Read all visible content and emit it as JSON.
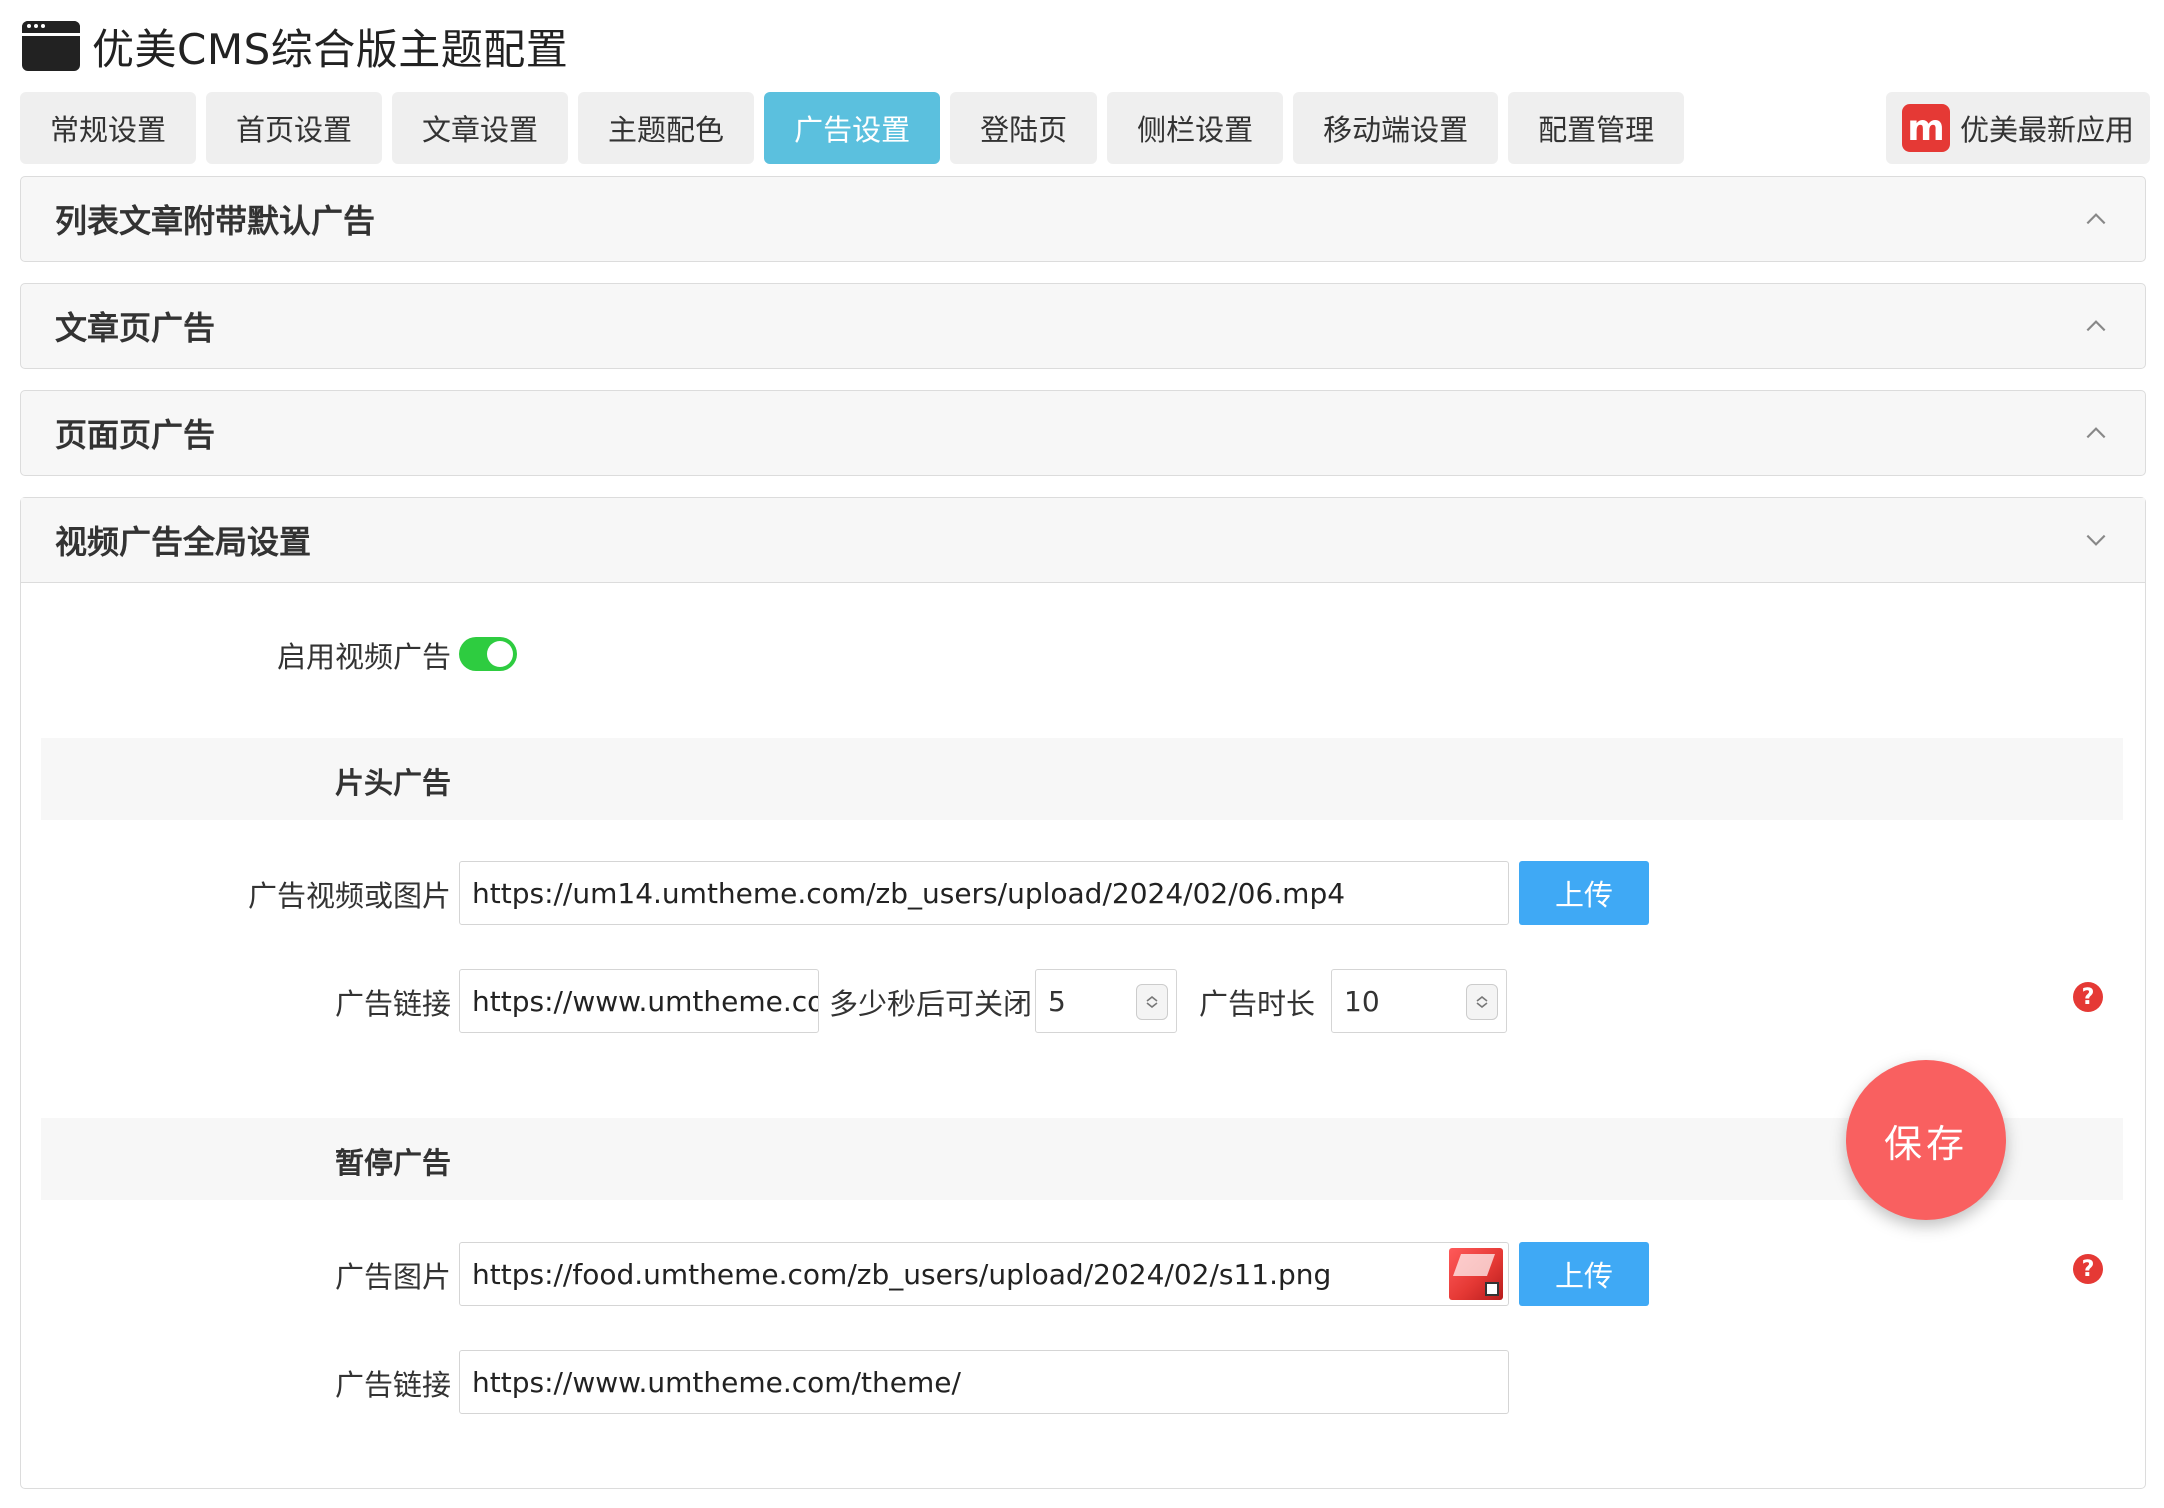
{
  "header": {
    "title": "优美CMS综合版主题配置"
  },
  "tabs": [
    {
      "label": "常规设置"
    },
    {
      "label": "首页设置"
    },
    {
      "label": "文章设置"
    },
    {
      "label": "主题配色"
    },
    {
      "label": "广告设置"
    },
    {
      "label": "登陆页"
    },
    {
      "label": "侧栏设置"
    },
    {
      "label": "移动端设置"
    },
    {
      "label": "配置管理"
    }
  ],
  "active_tab": "广告设置",
  "right_tab": {
    "label": "优美最新应用",
    "logo_glyph": "m"
  },
  "panels": [
    {
      "title": "列表文章附带默认广告"
    },
    {
      "title": "文章页广告"
    },
    {
      "title": "页面页广告"
    },
    {
      "title": "视频广告全局设置"
    }
  ],
  "video_ad": {
    "enable_label": "启用视频广告",
    "enabled": true,
    "preroll": {
      "section_title": "片头广告",
      "media_label": "广告视频或图片",
      "media_value": "https://um14.umtheme.com/zb_users/upload/2024/02/06.mp4",
      "upload_label": "上传",
      "link_label": "广告链接",
      "link_value": "https://www.umtheme.com/theme/",
      "close_after_label": "多少秒后可关闭",
      "close_after_value": "5",
      "duration_label": "广告时长",
      "duration_value": "10"
    },
    "pause": {
      "section_title": "暂停广告",
      "image_label": "广告图片",
      "image_value": "https://food.umtheme.com/zb_users/upload/2024/02/s11.png",
      "upload_label": "上传",
      "link_label": "广告链接",
      "link_value": "https://www.umtheme.com/theme/"
    }
  },
  "help_glyph": "?",
  "save_label": "保存",
  "colors": {
    "active_tab": "#5bc0de",
    "upload_button": "#3fa9f5",
    "save_button": "#f96060",
    "toggle_on": "#2ecc40",
    "help_badge": "#e53935"
  }
}
